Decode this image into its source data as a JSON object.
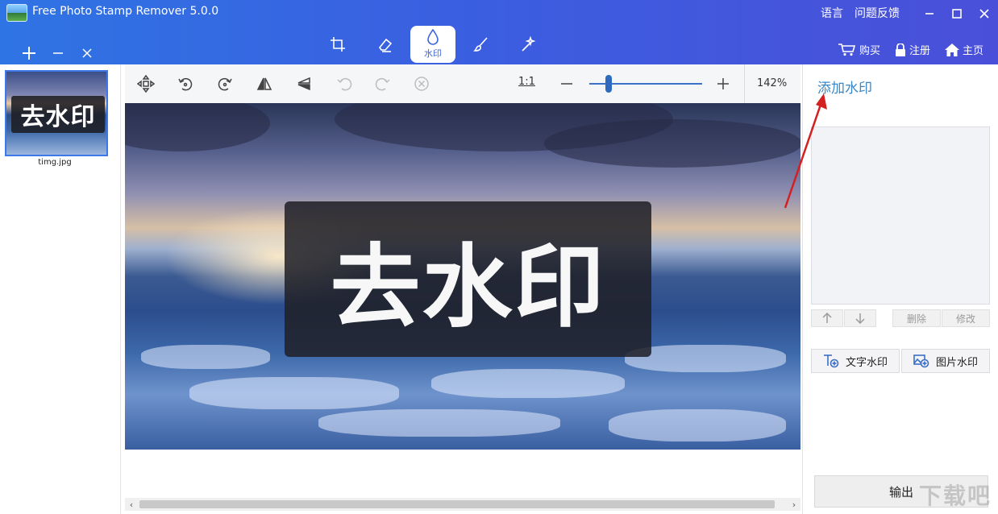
{
  "window": {
    "title": "Free Photo Stamp Remover 5.0.0",
    "top_links": [
      "语言",
      "问题反馈"
    ]
  },
  "modes": {
    "crop": "crop-icon",
    "eraser": "eraser-icon",
    "watermark_label": "水印",
    "brush": "brush-icon",
    "magic": "magic-wand-icon"
  },
  "header_actions": {
    "buy": "购买",
    "register": "注册",
    "home": "主页"
  },
  "files": [
    {
      "name": "timg.jpg",
      "thumb_text": "去水印"
    }
  ],
  "toolbar": {
    "ratio": "1:1",
    "zoom_percent": "142%",
    "zoom_level": 0.17
  },
  "canvas": {
    "watermark_text": "去水印"
  },
  "right_panel": {
    "title": "添加水印",
    "delete": "删除",
    "modify": "修改",
    "text_watermark": "文字水印",
    "image_watermark": "图片水印",
    "export": "输出"
  },
  "colors": {
    "titlebar_start": "#2f74e4",
    "titlebar_end": "#4a4fd9",
    "accent": "#3b66e0",
    "link": "#3a87c8",
    "annotation": "#d32020"
  },
  "site_watermark": "下载吧"
}
